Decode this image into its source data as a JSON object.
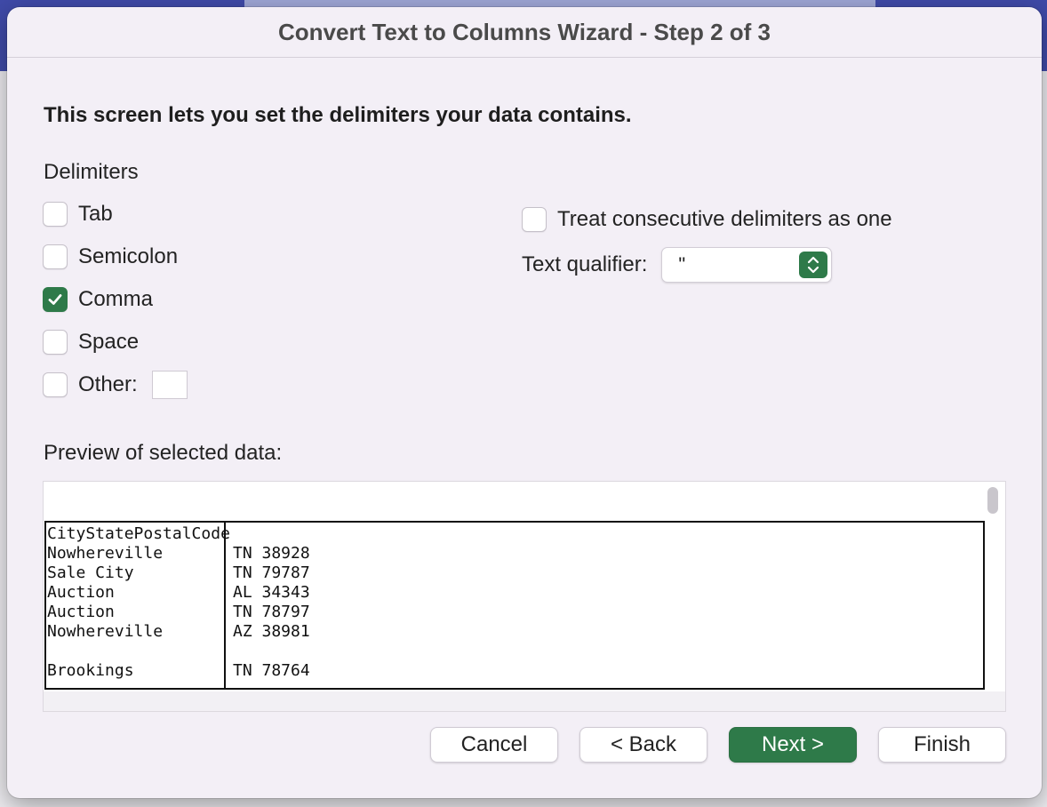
{
  "dialog": {
    "title": "Convert Text to Columns Wizard - Step 2 of 3",
    "heading": "This screen lets you set the delimiters your data contains."
  },
  "delimiters": {
    "label": "Delimiters",
    "options": [
      {
        "label": "Tab",
        "checked": false
      },
      {
        "label": "Semicolon",
        "checked": false
      },
      {
        "label": "Comma",
        "checked": true
      },
      {
        "label": "Space",
        "checked": false
      },
      {
        "label": "Other:",
        "checked": false
      }
    ],
    "other_value": ""
  },
  "options": {
    "consecutive_label": "Treat consecutive delimiters as one",
    "consecutive_checked": false,
    "qualifier_label": "Text qualifier:",
    "qualifier_value": "\""
  },
  "preview": {
    "label": "Preview of selected data:",
    "rows": [
      [
        "CityStatePostalCode",
        ""
      ],
      [
        "Nowhereville",
        "TN 38928"
      ],
      [
        "Sale City",
        "TN 79787"
      ],
      [
        "Auction",
        "AL 34343"
      ],
      [
        "Auction",
        "TN 78797"
      ],
      [
        "Nowhereville",
        "AZ 38981"
      ],
      [
        "",
        ""
      ],
      [
        "Brookings",
        "TN 78764"
      ]
    ]
  },
  "buttons": {
    "cancel": "Cancel",
    "back": "< Back",
    "next": "Next >",
    "finish": "Finish"
  },
  "colors": {
    "accent": "#2e7a49",
    "dialog_bg": "#f3eff6",
    "window_top": "#3f4aa8"
  }
}
